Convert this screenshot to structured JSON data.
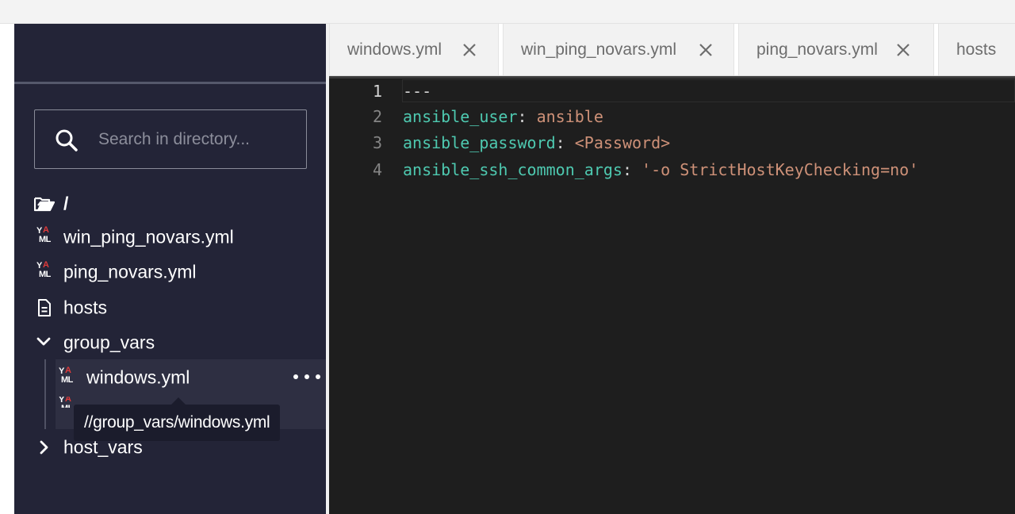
{
  "sidebar": {
    "search_placeholder": "Search in directory...",
    "root_label": "/",
    "items": [
      {
        "label": "win_ping_novars.yml",
        "icon": "yaml-icon"
      },
      {
        "label": "ping_novars.yml",
        "icon": "yaml-icon"
      },
      {
        "label": "hosts",
        "icon": "file-text-icon"
      },
      {
        "label": "group_vars",
        "icon": "chevron-down-icon"
      },
      {
        "label": "windows.yml",
        "icon": "yaml-icon"
      },
      {
        "label": "host_vars",
        "icon": "chevron-right-icon"
      }
    ],
    "tooltip": "//group_vars/windows.yml",
    "yaml_icon": {
      "y": "Y",
      "a": "A",
      "ml": "ML"
    }
  },
  "tabs": [
    {
      "label": "windows.yml"
    },
    {
      "label": "win_ping_novars.yml"
    },
    {
      "label": "ping_novars.yml"
    },
    {
      "label": "hosts"
    }
  ],
  "editor": {
    "lines": [
      {
        "number": "1",
        "key": "",
        "sep": "",
        "value": "---"
      },
      {
        "number": "2",
        "key": "ansible_user",
        "sep": ": ",
        "value": "ansible"
      },
      {
        "number": "3",
        "key": "ansible_password",
        "sep": ": ",
        "value": "<Password>"
      },
      {
        "number": "4",
        "key": "ansible_ssh_common_args",
        "sep": ": ",
        "value": "'-o StrictHostKeyChecking=no'"
      }
    ]
  },
  "colors": {
    "sidebar_bg": "#232437",
    "editor_bg": "#1e1e1e",
    "yaml_key": "#4ec9b0",
    "yaml_value": "#ce9178",
    "yaml_accent": "#e03b3b"
  }
}
